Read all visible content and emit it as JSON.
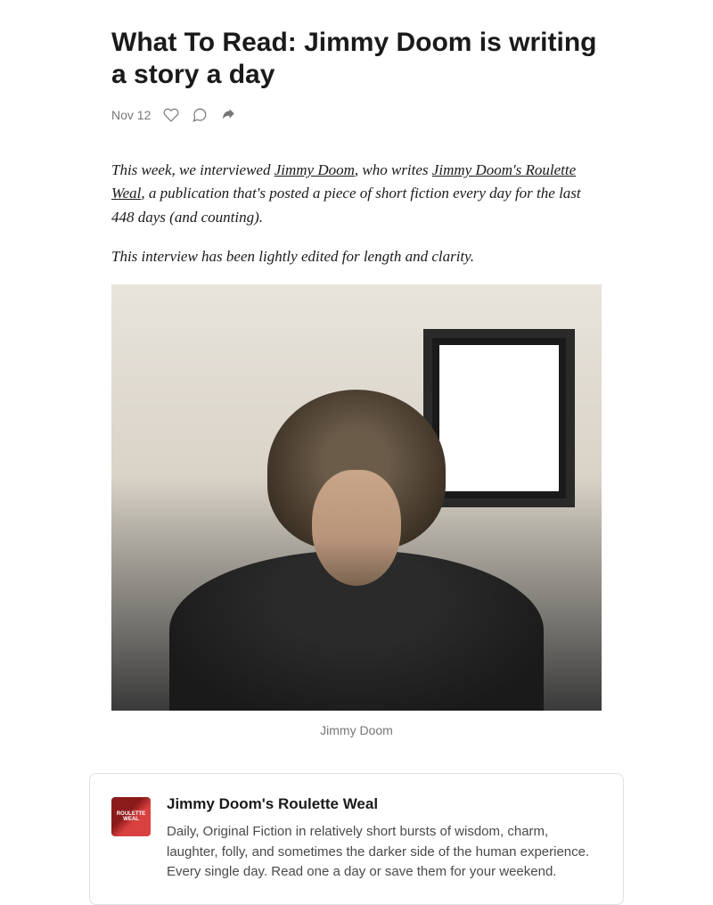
{
  "article": {
    "title": "What To Read: Jimmy Doom is writing a story a day",
    "date": "Nov 12",
    "intro_prefix": "This week, we interviewed ",
    "link_author": "Jimmy Doom",
    "intro_mid": ", who writes ",
    "link_publication": "Jimmy Doom's Roulette Weal",
    "intro_suffix": ", a publication that's posted a piece of short fiction every day for the last 448 days (and counting).",
    "edited_note": "This interview has been lightly edited for length and clarity.",
    "image_caption": "Jimmy Doom"
  },
  "publication_card": {
    "title": "Jimmy Doom's Roulette Weal",
    "description": "Daily, Original Fiction in relatively short bursts of wisdom, charm, laughter, folly, and sometimes the darker side of the human experience. Every single day. Read one a day or save them for your weekend.",
    "logo_text": "ROULETTE WEAL"
  }
}
